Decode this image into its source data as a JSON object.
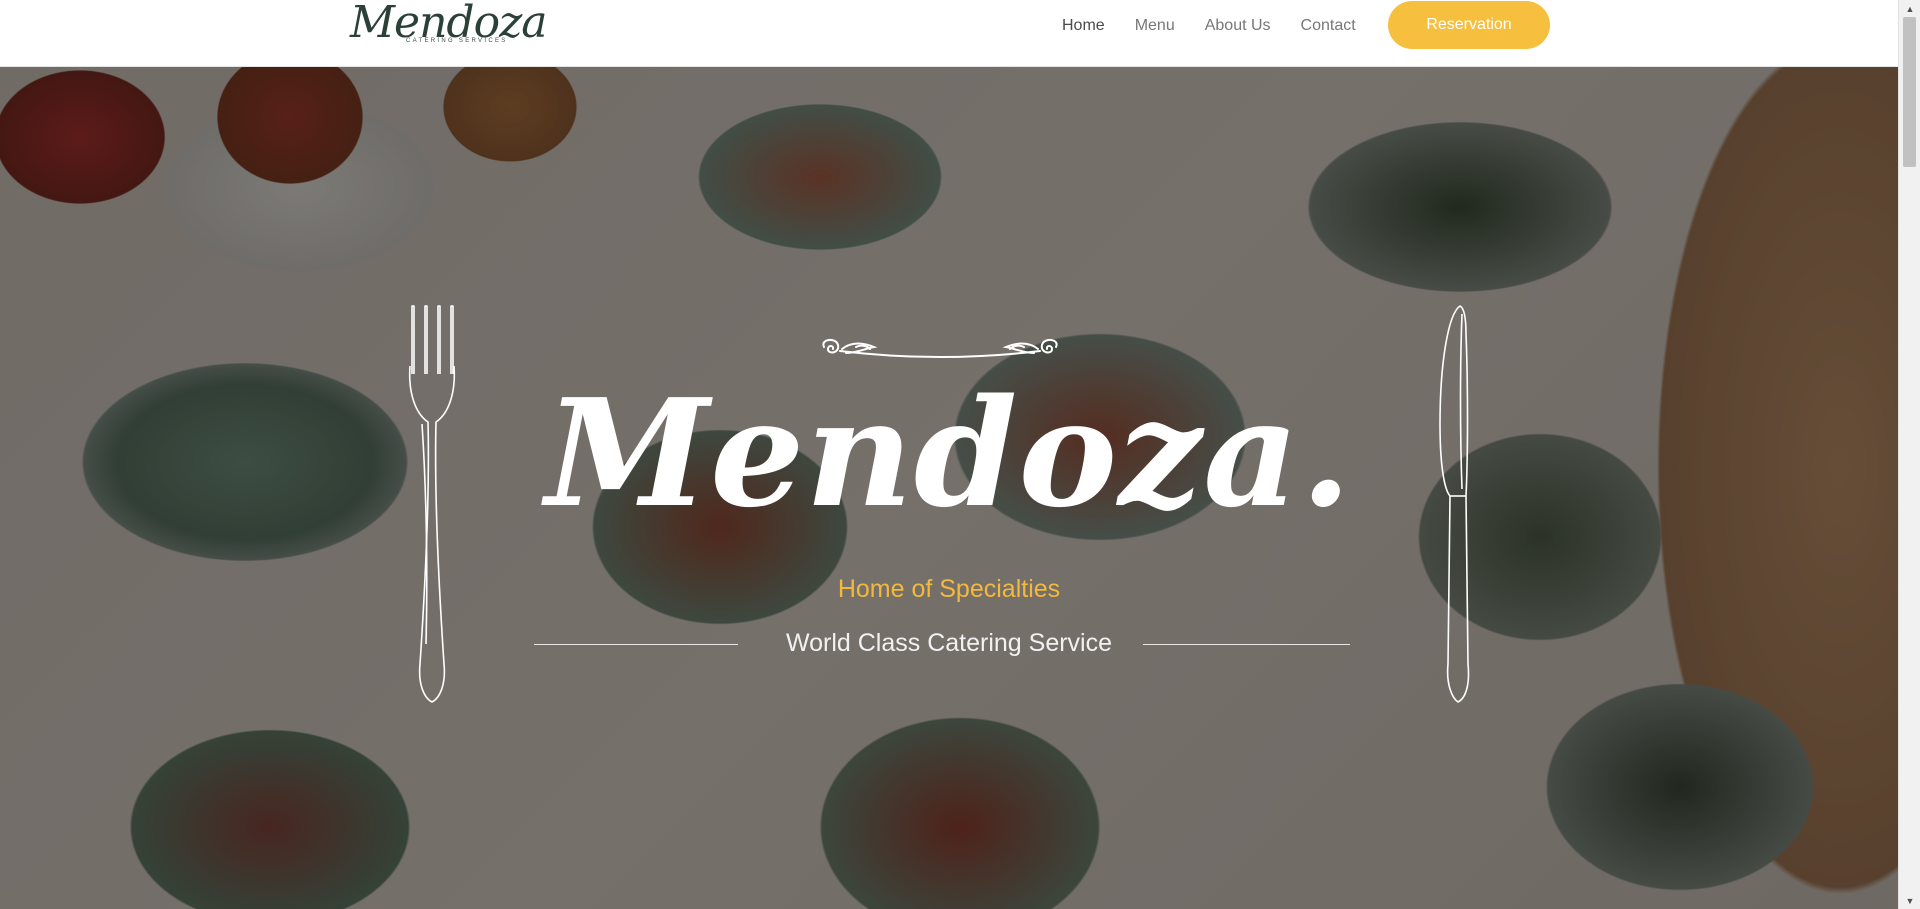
{
  "header": {
    "logo": {
      "word": "Mendoza",
      "sub": "CATERING SERVICES"
    },
    "nav": [
      {
        "label": "Home",
        "active": true
      },
      {
        "label": "Menu",
        "active": false
      },
      {
        "label": "About Us",
        "active": false
      },
      {
        "label": "Contact",
        "active": false
      }
    ],
    "reservation_label": "Reservation"
  },
  "hero": {
    "title": "Mendoza.",
    "tagline": "Home of Specialties",
    "subtitle": "World Class Catering Service",
    "icons": [
      "scroll-ornament-icon",
      "fork-icon",
      "knife-icon"
    ]
  },
  "scrollbar": {
    "up_arrow": "▲",
    "down_arrow": "▼"
  },
  "colors": {
    "accent": "#f7bf3e",
    "tagline": "#f4b93a",
    "logo": "#2b4138",
    "nav_text": "#777777"
  }
}
